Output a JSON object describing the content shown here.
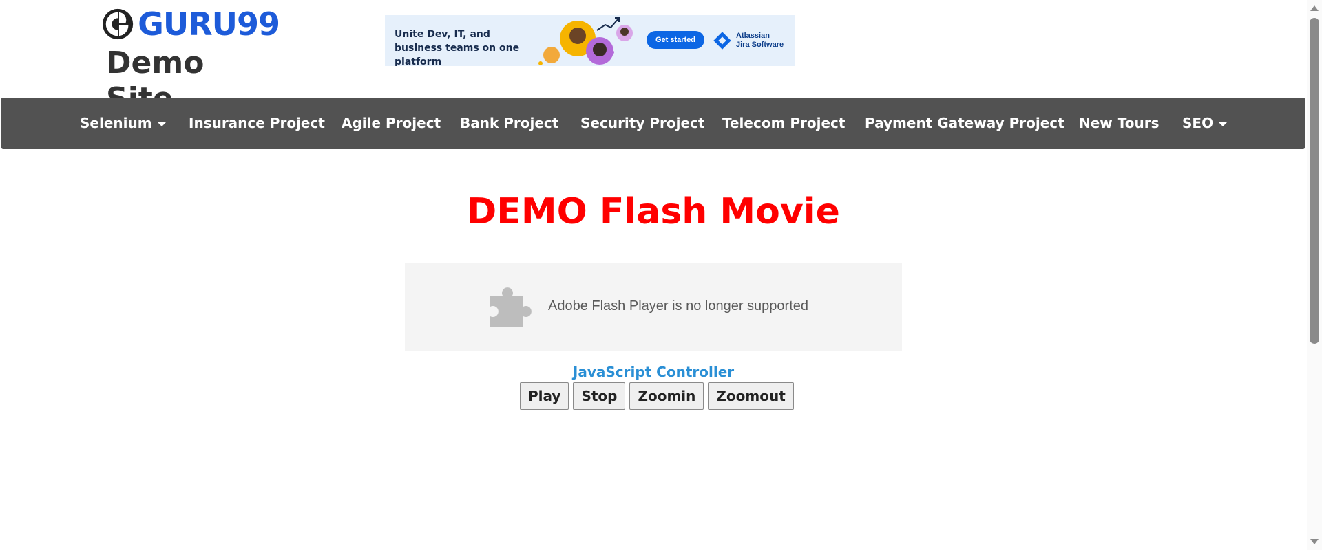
{
  "header": {
    "logo_text": "GURU99",
    "site_name": "Demo Site"
  },
  "ad": {
    "headline": "Unite Dev, IT, and business teams on one platform",
    "cta": "Get started",
    "brand_line1": "Atlassian",
    "brand_line2": "Jira Software"
  },
  "nav": {
    "items": [
      {
        "label": "Selenium",
        "dropdown": true
      },
      {
        "label": "Insurance Project"
      },
      {
        "label": "Agile Project"
      },
      {
        "label": "Bank Project"
      },
      {
        "label": "Security Project"
      },
      {
        "label": "Telecom Project"
      },
      {
        "label": "Payment Gateway Project"
      },
      {
        "label": "New Tours"
      },
      {
        "label": "SEO",
        "dropdown": true
      }
    ]
  },
  "main": {
    "title": "DEMO Flash Movie",
    "flash_message": "Adobe Flash Player is no longer supported",
    "controller_label": "JavaScript Controller",
    "buttons": [
      "Play",
      "Stop",
      "Zoomin",
      "Zoomout"
    ]
  },
  "colors": {
    "brand_blue": "#1d5bd9",
    "nav_bg": "#525252",
    "title_red": "#ff0000",
    "link_blue": "#2a8fd5"
  }
}
